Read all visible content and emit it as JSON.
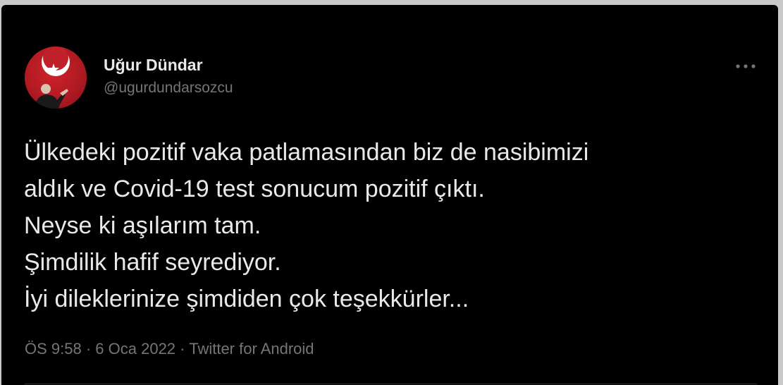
{
  "tweet": {
    "author": {
      "display_name": "Uğur Dündar",
      "handle": "@ugurdundarsozcu",
      "avatar_icon": "crescent-star-flag-icon"
    },
    "more_icon": "ellipsis-icon",
    "text_lines": [
      "Ülkedeki pozitif vaka patlamasından biz de nasibimizi",
      "aldık ve Covid-19 test sonucum pozitif çıktı.",
      "Neyse ki aşılarım tam.",
      "Şimdilik hafif seyrediyor.",
      "İyi dileklerinize şimdiden çok teşekkürler..."
    ],
    "meta": {
      "time": "ÖS 9:58",
      "separator": "·",
      "date": "6 Oca 2022",
      "source": "Twitter for Android"
    }
  },
  "colors": {
    "background": "#000000",
    "text_primary": "#e7e9ea",
    "text_secondary": "#71767b",
    "avatar_red": "#c0202a"
  }
}
